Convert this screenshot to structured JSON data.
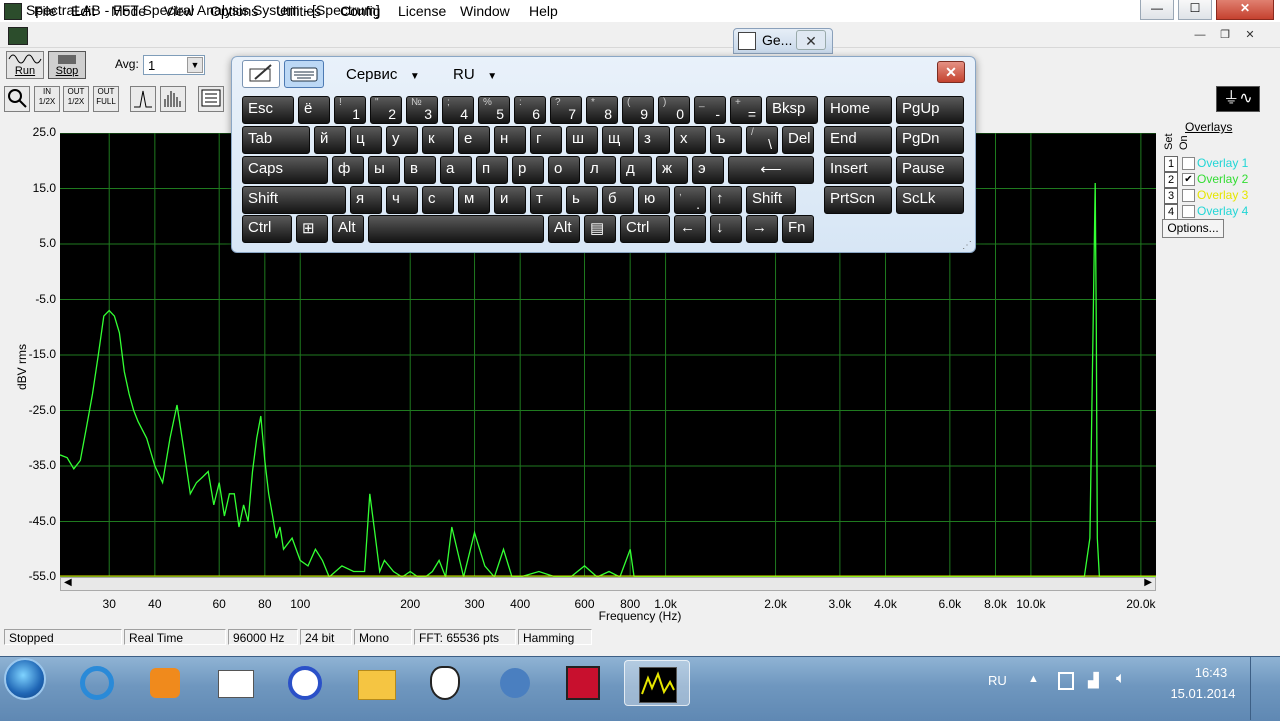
{
  "window": {
    "title": "SpectraLAB - FFT Spectral Analysis System - [Spectrum]",
    "min_glyph": "—",
    "max_glyph": "☐",
    "close_glyph": "✕"
  },
  "menu": {
    "items": [
      "File",
      "Edit",
      "Mode",
      "View",
      "Options",
      "Utilities",
      "Config",
      "License",
      "Window",
      "Help"
    ],
    "mdi_min": "—",
    "mdi_restore": "❐",
    "mdi_close": "✕"
  },
  "toolbar": {
    "run_label": "Run",
    "stop_label": "Stop",
    "avg_label": "Avg:",
    "avg_value": "1",
    "btn_in12x": "IN 1/2X",
    "btn_out12x": "OUT 1/2X",
    "btn_outfull": "OUT FULL"
  },
  "ge_window": {
    "label": "Ge...",
    "close": "✕"
  },
  "osk": {
    "service_label": "Сервис",
    "lang_label": "RU",
    "close_glyph": "✕",
    "rows": [
      [
        {
          "m": "Esc",
          "w": 54
        },
        {
          "m": "ё",
          "w": 34
        },
        {
          "s": "!",
          "b": "1",
          "w": 34
        },
        {
          "s": "\"",
          "b": "2",
          "w": 34
        },
        {
          "s": "№",
          "b": "3",
          "w": 34
        },
        {
          "s": ";",
          "b": "4",
          "w": 34
        },
        {
          "s": "%",
          "b": "5",
          "w": 34
        },
        {
          "s": ":",
          "b": "6",
          "w": 34
        },
        {
          "s": "?",
          "b": "7",
          "w": 34
        },
        {
          "s": "*",
          "b": "8",
          "w": 34
        },
        {
          "s": "(",
          "b": "9",
          "w": 34
        },
        {
          "s": ")",
          "b": "0",
          "w": 34
        },
        {
          "s": "_",
          "b": "-",
          "w": 34
        },
        {
          "s": "+",
          "b": "=",
          "w": 34
        },
        {
          "m": "Bksp",
          "w": 54
        }
      ],
      [
        {
          "m": "Tab",
          "w": 70
        },
        {
          "m": "й",
          "w": 34
        },
        {
          "m": "ц",
          "w": 34
        },
        {
          "m": "у",
          "w": 34
        },
        {
          "m": "к",
          "w": 34
        },
        {
          "m": "е",
          "w": 34
        },
        {
          "m": "н",
          "w": 34
        },
        {
          "m": "г",
          "w": 34
        },
        {
          "m": "ш",
          "w": 34
        },
        {
          "m": "щ",
          "w": 34
        },
        {
          "m": "з",
          "w": 34
        },
        {
          "m": "х",
          "w": 34
        },
        {
          "m": "ъ",
          "w": 34
        },
        {
          "s": "/",
          "b": "\\",
          "w": 34
        },
        {
          "m": "Del",
          "w": 34
        }
      ],
      [
        {
          "m": "Caps",
          "w": 88
        },
        {
          "m": "ф",
          "w": 34
        },
        {
          "m": "ы",
          "w": 34
        },
        {
          "m": "в",
          "w": 34
        },
        {
          "m": "а",
          "w": 34
        },
        {
          "m": "п",
          "w": 34
        },
        {
          "m": "р",
          "w": 34
        },
        {
          "m": "о",
          "w": 34
        },
        {
          "m": "л",
          "w": 34
        },
        {
          "m": "д",
          "w": 34
        },
        {
          "m": "ж",
          "w": 34
        },
        {
          "m": "э",
          "w": 34
        },
        {
          "m": "⟵",
          "w": 88,
          "c": true
        }
      ],
      [
        {
          "m": "Shift",
          "w": 106
        },
        {
          "m": "я",
          "w": 34
        },
        {
          "m": "ч",
          "w": 34
        },
        {
          "m": "с",
          "w": 34
        },
        {
          "m": "м",
          "w": 34
        },
        {
          "m": "и",
          "w": 34
        },
        {
          "m": "т",
          "w": 34
        },
        {
          "m": "ь",
          "w": 34
        },
        {
          "m": "б",
          "w": 34
        },
        {
          "m": "ю",
          "w": 34
        },
        {
          "s": ",",
          "b": ".",
          "w": 34
        },
        {
          "m": "↑",
          "w": 34
        },
        {
          "m": "Shift",
          "w": 52
        }
      ],
      [
        {
          "m": "Ctrl",
          "w": 52
        },
        {
          "m": "⊞",
          "w": 34
        },
        {
          "m": "Alt",
          "w": 34
        },
        {
          "m": "",
          "w": 178
        },
        {
          "m": "Alt",
          "w": 34
        },
        {
          "m": "▤",
          "w": 34
        },
        {
          "m": "Ctrl",
          "w": 52
        },
        {
          "m": "←",
          "w": 34
        },
        {
          "m": "↓",
          "w": 34
        },
        {
          "m": "→",
          "w": 34
        },
        {
          "m": "Fn",
          "w": 34
        }
      ]
    ],
    "nav": [
      [
        "Home",
        "PgUp"
      ],
      [
        "End",
        "PgDn"
      ],
      [
        "Insert",
        "Pause"
      ],
      [
        "PrtScn",
        "ScLk"
      ]
    ]
  },
  "overlays": {
    "title": "Overlays",
    "set_label": "Set",
    "on_label": "On",
    "options_label": "Options...",
    "items": [
      {
        "num": "1",
        "label": "Overlay 1",
        "checked": false,
        "color": "#22d6d6"
      },
      {
        "num": "2",
        "label": "Overlay 2",
        "checked": true,
        "color": "#33dd33"
      },
      {
        "num": "3",
        "label": "Overlay 3",
        "checked": false,
        "color": "#e6e600"
      },
      {
        "num": "4",
        "label": "Overlay 4",
        "checked": false,
        "color": "#22d6d6"
      }
    ]
  },
  "chart_data": {
    "type": "line",
    "xlabel": "Frequency (Hz)",
    "ylabel": "dBV rms",
    "x_scale": "log",
    "xlim": [
      22,
      22000
    ],
    "ylim": [
      -55,
      25
    ],
    "yticks": [
      "25.0",
      "15.0",
      "5.0",
      "-5.0",
      "-15.0",
      "-25.0",
      "-35.0",
      "-45.0",
      "-55.0"
    ],
    "xticks": [
      {
        "v": 30,
        "l": "30"
      },
      {
        "v": 40,
        "l": "40"
      },
      {
        "v": 60,
        "l": "60"
      },
      {
        "v": 80,
        "l": "80"
      },
      {
        "v": 100,
        "l": "100"
      },
      {
        "v": 200,
        "l": "200"
      },
      {
        "v": 300,
        "l": "300"
      },
      {
        "v": 400,
        "l": "400"
      },
      {
        "v": 600,
        "l": "600"
      },
      {
        "v": 800,
        "l": "800"
      },
      {
        "v": 1000,
        "l": "1.0k"
      },
      {
        "v": 2000,
        "l": "2.0k"
      },
      {
        "v": 3000,
        "l": "3.0k"
      },
      {
        "v": 4000,
        "l": "4.0k"
      },
      {
        "v": 6000,
        "l": "6.0k"
      },
      {
        "v": 8000,
        "l": "8.0k"
      },
      {
        "v": 10000,
        "l": "10.0k"
      },
      {
        "v": 20000,
        "l": "20.0k"
      }
    ],
    "grid": true,
    "line_color": "#33ff33",
    "series": [
      {
        "x": [
          22,
          23,
          24,
          25,
          26,
          27,
          28,
          29,
          30,
          31,
          32,
          33,
          34,
          35,
          36,
          38,
          40,
          42,
          44,
          46,
          48,
          50,
          52,
          54,
          56,
          58,
          60,
          62,
          64,
          66,
          68,
          70,
          72,
          74,
          76,
          78,
          80,
          82,
          84,
          86,
          88,
          90,
          95,
          100,
          105,
          110,
          115,
          120,
          130,
          140,
          150,
          155,
          160,
          165,
          170,
          180,
          190,
          200,
          210,
          220,
          230,
          240,
          250,
          260,
          280,
          300,
          320,
          340,
          360,
          380,
          400,
          450,
          500,
          550,
          600,
          650,
          700,
          750,
          780,
          800,
          820,
          900,
          1000,
          1500,
          2000,
          3000,
          5000,
          8000,
          10000,
          12000,
          14000,
          14500,
          14800,
          15000,
          15100,
          15200,
          15400,
          16000,
          18000,
          20000,
          22000
        ],
        "y": [
          -33,
          -33.5,
          -35.5,
          -34,
          -28,
          -22,
          -15,
          -8,
          -7,
          -8,
          -11,
          -18,
          -22,
          -25,
          -27,
          -30,
          -35,
          -38,
          -30,
          -24,
          -32,
          -40,
          -38,
          -37,
          -36,
          -42,
          -38,
          -44,
          -40,
          -40,
          -46,
          -42,
          -45,
          -36,
          -30,
          -26,
          -34,
          -40,
          -44,
          -48,
          -46,
          -50,
          -48,
          -52,
          -53,
          -50,
          -52,
          -55,
          -53,
          -54,
          -54,
          -40,
          -47,
          -54,
          -52,
          -54,
          -55,
          -54,
          -55,
          -55,
          -54,
          -52,
          -55,
          -46,
          -55,
          -47,
          -53,
          -55,
          -50,
          -55,
          -55,
          -54,
          -55,
          -55,
          -53,
          -55,
          -54,
          -55,
          -52,
          -50,
          -55,
          -55,
          -55,
          -55,
          -55,
          -55,
          -55,
          -55,
          -55,
          -55,
          -55,
          -48,
          -10,
          16,
          -10,
          -48,
          -55,
          -55,
          -55,
          -55,
          -55
        ]
      }
    ]
  },
  "status": [
    "Stopped",
    "Real Time",
    "96000 Hz",
    "24 bit",
    "Mono",
    "FFT: 65536 pts",
    "Hamming"
  ],
  "taskbar": {
    "lang": "RU",
    "time": "16:43",
    "date": "15.01.2014"
  }
}
